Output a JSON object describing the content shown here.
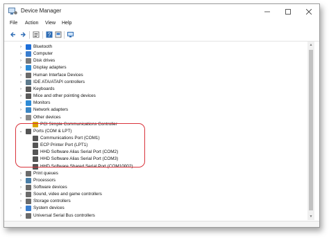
{
  "window": {
    "title": "Device Manager"
  },
  "menu": [
    "File",
    "Action",
    "View",
    "Help"
  ],
  "toolbar": [
    "back-icon",
    "forward-icon",
    "properties-icon",
    "help-icon",
    "scan-icon"
  ],
  "tree": {
    "categories": [
      {
        "label": "Bluetooth",
        "icon": "bluetooth-icon",
        "color": "#1e6fd9"
      },
      {
        "label": "Computer",
        "icon": "computer-icon",
        "color": "#3a7ecf"
      },
      {
        "label": "Disk drives",
        "icon": "disk-icon",
        "color": "#7a7a7a"
      },
      {
        "label": "Display adapters",
        "icon": "display-icon",
        "color": "#2e8bd6"
      },
      {
        "label": "Human Interface Devices",
        "icon": "hid-icon",
        "color": "#6b6b6b"
      },
      {
        "label": "IDE ATA/ATAPI controllers",
        "icon": "ide-icon",
        "color": "#5d7a8c"
      },
      {
        "label": "Keyboards",
        "icon": "keyboard-icon",
        "color": "#5a5a5a"
      },
      {
        "label": "Mice and other pointing devices",
        "icon": "mouse-icon",
        "color": "#5a5a5a"
      },
      {
        "label": "Monitors",
        "icon": "monitor-icon",
        "color": "#2e8bd6"
      },
      {
        "label": "Network adapters",
        "icon": "network-icon",
        "color": "#3b86c4"
      },
      {
        "label": "Other devices",
        "icon": "other-devices-icon",
        "color": "#8a8a8a"
      },
      {
        "label": "PCI Simple Communications Controller",
        "icon": "warning-device-icon",
        "color": "#d9a400"
      },
      {
        "label": "Ports (COM & LPT)",
        "icon": "port-icon",
        "color": "#555555"
      },
      {
        "label": "Communications Port (COM1)",
        "icon": "port-icon",
        "color": "#555555"
      },
      {
        "label": "ECP Printer Port (LPT1)",
        "icon": "port-icon",
        "color": "#555555"
      },
      {
        "label": "HHD Software Alias Serial Port (COM2)",
        "icon": "port-icon",
        "color": "#555555"
      },
      {
        "label": "HHD Software Alias Serial Port (COM3)",
        "icon": "port-icon",
        "color": "#555555"
      },
      {
        "label": "HHD Software Shared Serial Port (COM10002)",
        "icon": "port-icon",
        "color": "#555555"
      },
      {
        "label": "Print queues",
        "icon": "printer-icon",
        "color": "#6b6b6b"
      },
      {
        "label": "Processors",
        "icon": "processor-icon",
        "color": "#4a7fa8"
      },
      {
        "label": "Software devices",
        "icon": "software-device-icon",
        "color": "#6b6b6b"
      },
      {
        "label": "Sound, video and game controllers",
        "icon": "sound-icon",
        "color": "#6b6b6b"
      },
      {
        "label": "Storage controllers",
        "icon": "storage-icon",
        "color": "#6b6b6b"
      },
      {
        "label": "System devices",
        "icon": "system-device-icon",
        "color": "#3a7ecf"
      },
      {
        "label": "Universal Serial Bus controllers",
        "icon": "usb-icon",
        "color": "#6b6b6b"
      }
    ]
  },
  "colors": {
    "highlight": "#d9323a",
    "accent": "#1e6fd9"
  }
}
